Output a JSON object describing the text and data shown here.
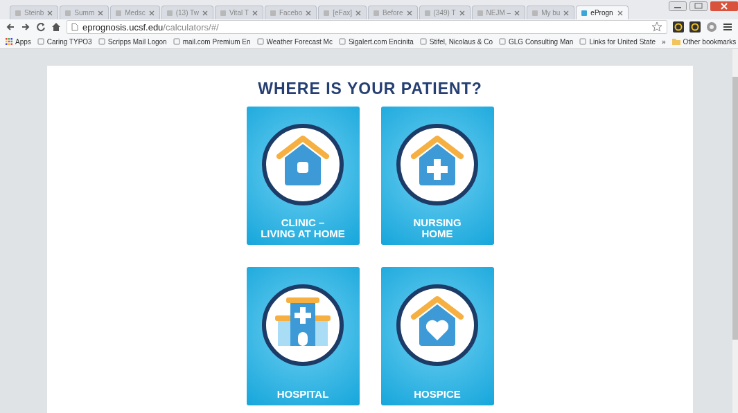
{
  "tabs": [
    {
      "label": "Steinb",
      "selected": false
    },
    {
      "label": "Summ",
      "selected": false
    },
    {
      "label": "Medsc",
      "selected": false
    },
    {
      "label": "(13) Tw",
      "selected": false
    },
    {
      "label": "Vital T",
      "selected": false
    },
    {
      "label": "Facebo",
      "selected": false
    },
    {
      "label": "[eFax]",
      "selected": false
    },
    {
      "label": "Before",
      "selected": false
    },
    {
      "label": "(349) T",
      "selected": false
    },
    {
      "label": "NEJM –",
      "selected": false
    },
    {
      "label": "My bu",
      "selected": false
    },
    {
      "label": "eProgn",
      "selected": true
    }
  ],
  "address_bar": {
    "domain": "eprognosis.ucsf.edu",
    "path": "/calculators/#/"
  },
  "bookmarks": [
    "Apps",
    "Caring TYPO3",
    "Scripps Mail Logon",
    "mail.com Premium En",
    "Weather Forecast Mc",
    "Sigalert.com Encinita",
    "Stifel, Nicolaus & Co",
    "GLG Consulting Man",
    "Links for United State"
  ],
  "bookmarks_overflow": "»",
  "other_bookmarks": "Other bookmarks",
  "heading": "WHERE IS YOUR PATIENT?",
  "options": [
    {
      "label": "CLINIC –\nLIVING AT HOME",
      "kind": "home"
    },
    {
      "label": "NURSING\nHOME",
      "kind": "nursing"
    },
    {
      "label": "HOSPITAL",
      "kind": "hospital"
    },
    {
      "label": "HOSPICE",
      "kind": "hospice"
    }
  ]
}
